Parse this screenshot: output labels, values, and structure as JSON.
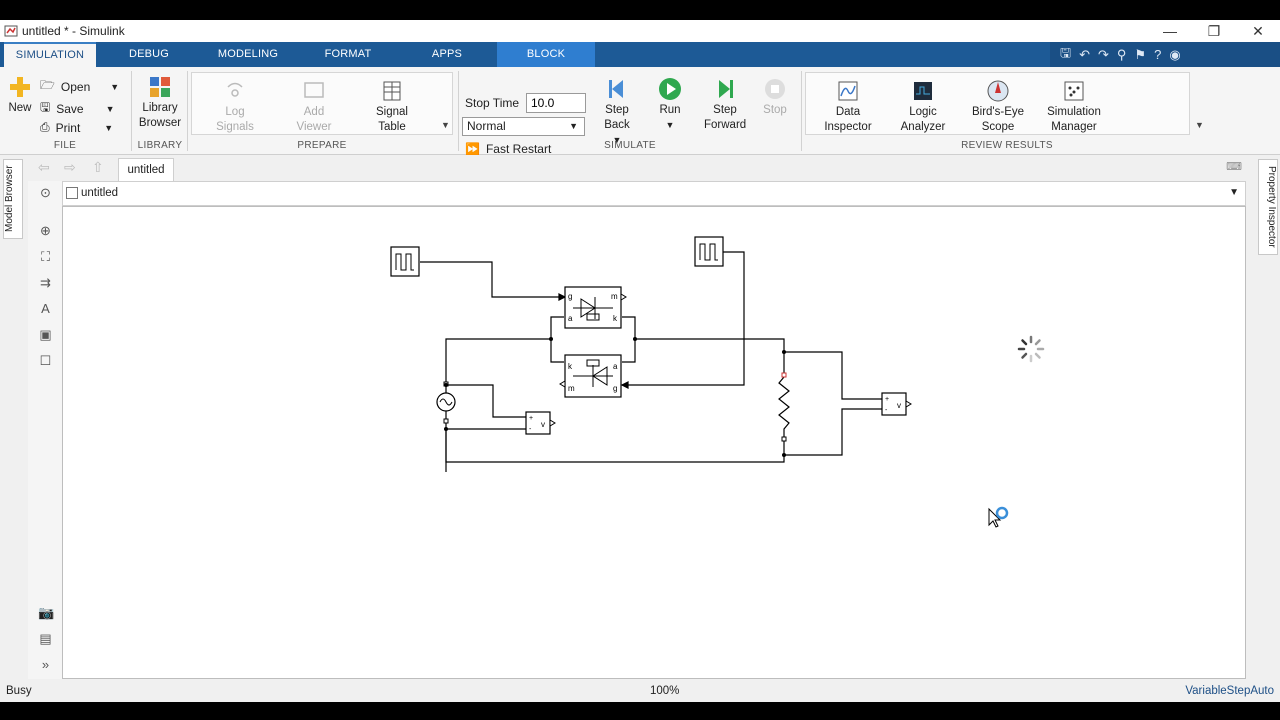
{
  "window": {
    "title": "untitled * - Simulink"
  },
  "tabs": [
    "SIMULATION",
    "DEBUG",
    "MODELING",
    "FORMAT",
    "APPS",
    "BLOCK"
  ],
  "file": {
    "new": "New",
    "open": "Open",
    "save": "Save",
    "print": "Print",
    "label": "FILE"
  },
  "library": {
    "browser": "Library Browser",
    "label": "LIBRARY"
  },
  "prepare": {
    "log_signals": "Log Signals",
    "add_viewer": "Add Viewer",
    "signal_table": "Signal Table",
    "label": "PREPARE"
  },
  "simulate": {
    "stop_time_label": "Stop Time",
    "stop_time_value": "10.0",
    "mode": "Normal",
    "fast_restart": "Fast Restart",
    "step_back": "Step Back",
    "run": "Run",
    "step_forward": "Step Forward",
    "stop": "Stop",
    "label": "SIMULATE"
  },
  "review": {
    "data_inspector": "Data Inspector",
    "logic_analyzer": "Logic Analyzer",
    "birds_eye": "Bird's-Eye Scope",
    "sim_manager": "Simulation Manager",
    "label": "REVIEW RESULTS"
  },
  "side_tabs": {
    "left": "Model Browser",
    "right": "Property Inspector"
  },
  "editor": {
    "doc_tab": "untitled",
    "address": "untitled"
  },
  "diagram_labels": {
    "volt_meas": "v",
    "plus": "+",
    "minus": "-",
    "g": "g",
    "m": "m",
    "a": "a",
    "k": "k"
  },
  "status": {
    "state": "Busy",
    "zoom": "100%",
    "solver": "VariableStepAuto"
  },
  "colors": {
    "ribbon": "#1d5a96",
    "accent": "#2f7ed0",
    "run_green": "#2fa84f",
    "busy_spinner": "#3a8fd9"
  }
}
